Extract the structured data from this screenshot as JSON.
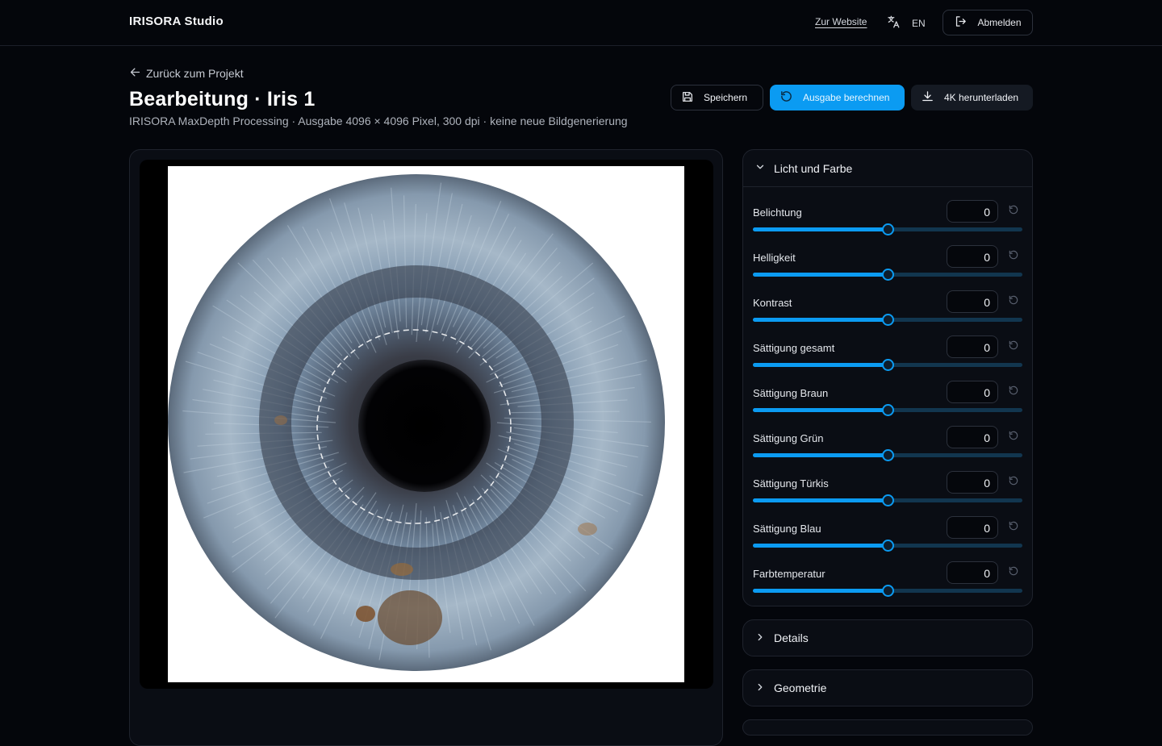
{
  "header": {
    "brand": "IRISORA Studio",
    "website_link": "Zur Website",
    "language": "EN",
    "logout_label": "Abmelden"
  },
  "page": {
    "back_label": "Zurück zum Projekt",
    "title": "Bearbeitung · Iris 1",
    "subtitle": "IRISORA MaxDepth Processing · Ausgabe 4096 × 4096 Pixel, 300 dpi · keine neue Bildgenerierung"
  },
  "toolbar": {
    "save_label": "Speichern",
    "compute_label": "Ausgabe berechnen",
    "download_label": "4K herunterladen"
  },
  "colors": {
    "accent": "#0b9bf2",
    "background": "#04060b",
    "card": "#0a0d14"
  },
  "panel": {
    "title": "Licht und Farbe",
    "expanded": true,
    "sliders": [
      {
        "label": "Belichtung",
        "value": "0",
        "level": 0.5
      },
      {
        "label": "Helligkeit",
        "value": "0",
        "level": 0.5
      },
      {
        "label": "Kontrast",
        "value": "0",
        "level": 0.5
      },
      {
        "label": "Sättigung gesamt",
        "value": "0",
        "level": 0.5
      },
      {
        "label": "Sättigung Braun",
        "value": "0",
        "level": 0.5
      },
      {
        "label": "Sättigung Grün",
        "value": "0",
        "level": 0.5
      },
      {
        "label": "Sättigung Türkis",
        "value": "0",
        "level": 0.5
      },
      {
        "label": "Sättigung Blau",
        "value": "0",
        "level": 0.5
      },
      {
        "label": "Farbtemperatur",
        "value": "0",
        "level": 0.5
      }
    ]
  },
  "sections": [
    {
      "label": "Details",
      "expanded": false
    },
    {
      "label": "Geometrie",
      "expanded": false
    }
  ],
  "icons": {
    "language": "translate-icon",
    "logout": "logout-icon",
    "back": "arrow-left-icon",
    "save": "save-icon",
    "compute": "refresh-icon",
    "download": "download-icon",
    "reset": "reset-icon",
    "collapse": "chevron-down-icon",
    "expand": "chevron-right-icon"
  }
}
